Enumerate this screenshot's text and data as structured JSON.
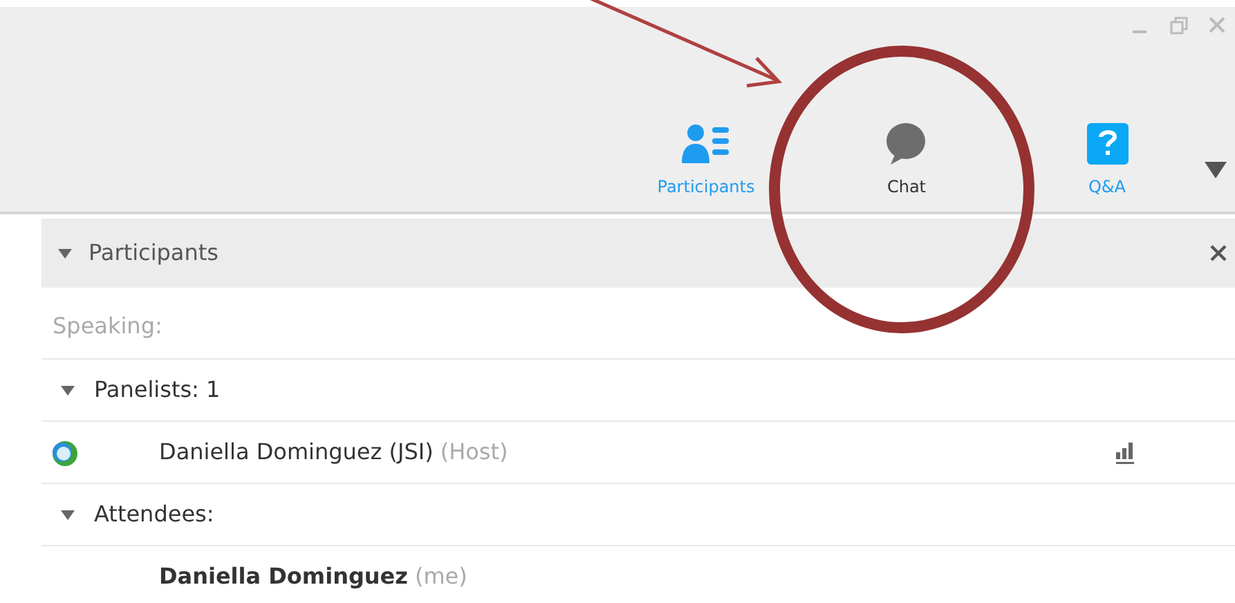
{
  "toolbar": [
    {
      "kind": "participants",
      "label": "Participants"
    },
    {
      "kind": "chat",
      "label": "Chat"
    },
    {
      "kind": "qa",
      "label": "Q&A"
    }
  ],
  "panel": {
    "title": "Participants",
    "expanded": true,
    "rows": [
      {
        "kind": "speaking",
        "label": "Speaking:"
      },
      {
        "kind": "group",
        "label": "Panelists: 1",
        "expanded": true
      },
      {
        "kind": "person",
        "name": "Daniella Dominguez (JSI)",
        "role": "(Host)",
        "me": false,
        "avatar": true,
        "audio": true
      },
      {
        "kind": "group",
        "label": "Attendees:",
        "expanded": true
      },
      {
        "kind": "person",
        "name": "Daniella Dominguez",
        "role": "(me)",
        "me": true,
        "avatar": false,
        "audio": false
      }
    ]
  },
  "annotation": {
    "kind": "circle-with-arrow"
  }
}
